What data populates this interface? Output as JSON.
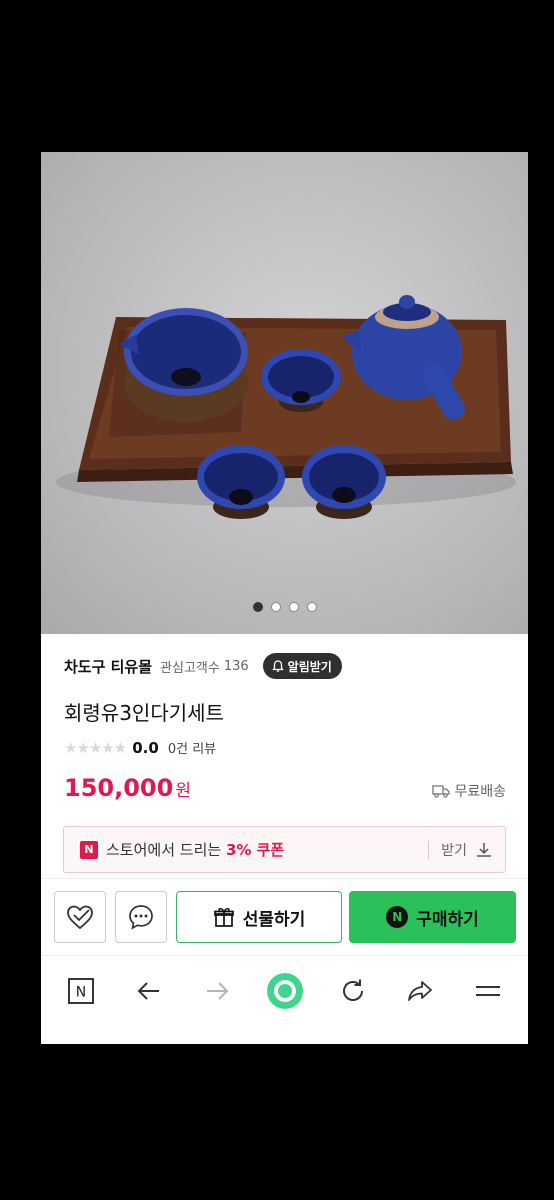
{
  "product_images": {
    "count": 4,
    "active_index": 0
  },
  "store": {
    "name": "차도구 티유몰",
    "followers_label": "관심고객수",
    "followers_count": "136",
    "alarm_button": "알림받기"
  },
  "product": {
    "title": "회령유3인다기세트",
    "rating": "0.0",
    "rating_stars_filled": 0,
    "rating_stars_total": 5,
    "review_text": "0건 리뷰",
    "price": "150,000",
    "currency": "원",
    "shipping": "무료배송"
  },
  "coupon": {
    "badge": "N",
    "text_before": "스토어에서 드리는 ",
    "percent": "3% 쿠폰",
    "get_label": "받기"
  },
  "actions": {
    "gift_label": "선물하기",
    "buy_badge": "N",
    "buy_label": "구매하기"
  },
  "browser_nav": {
    "home_badge": "N",
    "accent": "#3dd68c"
  }
}
